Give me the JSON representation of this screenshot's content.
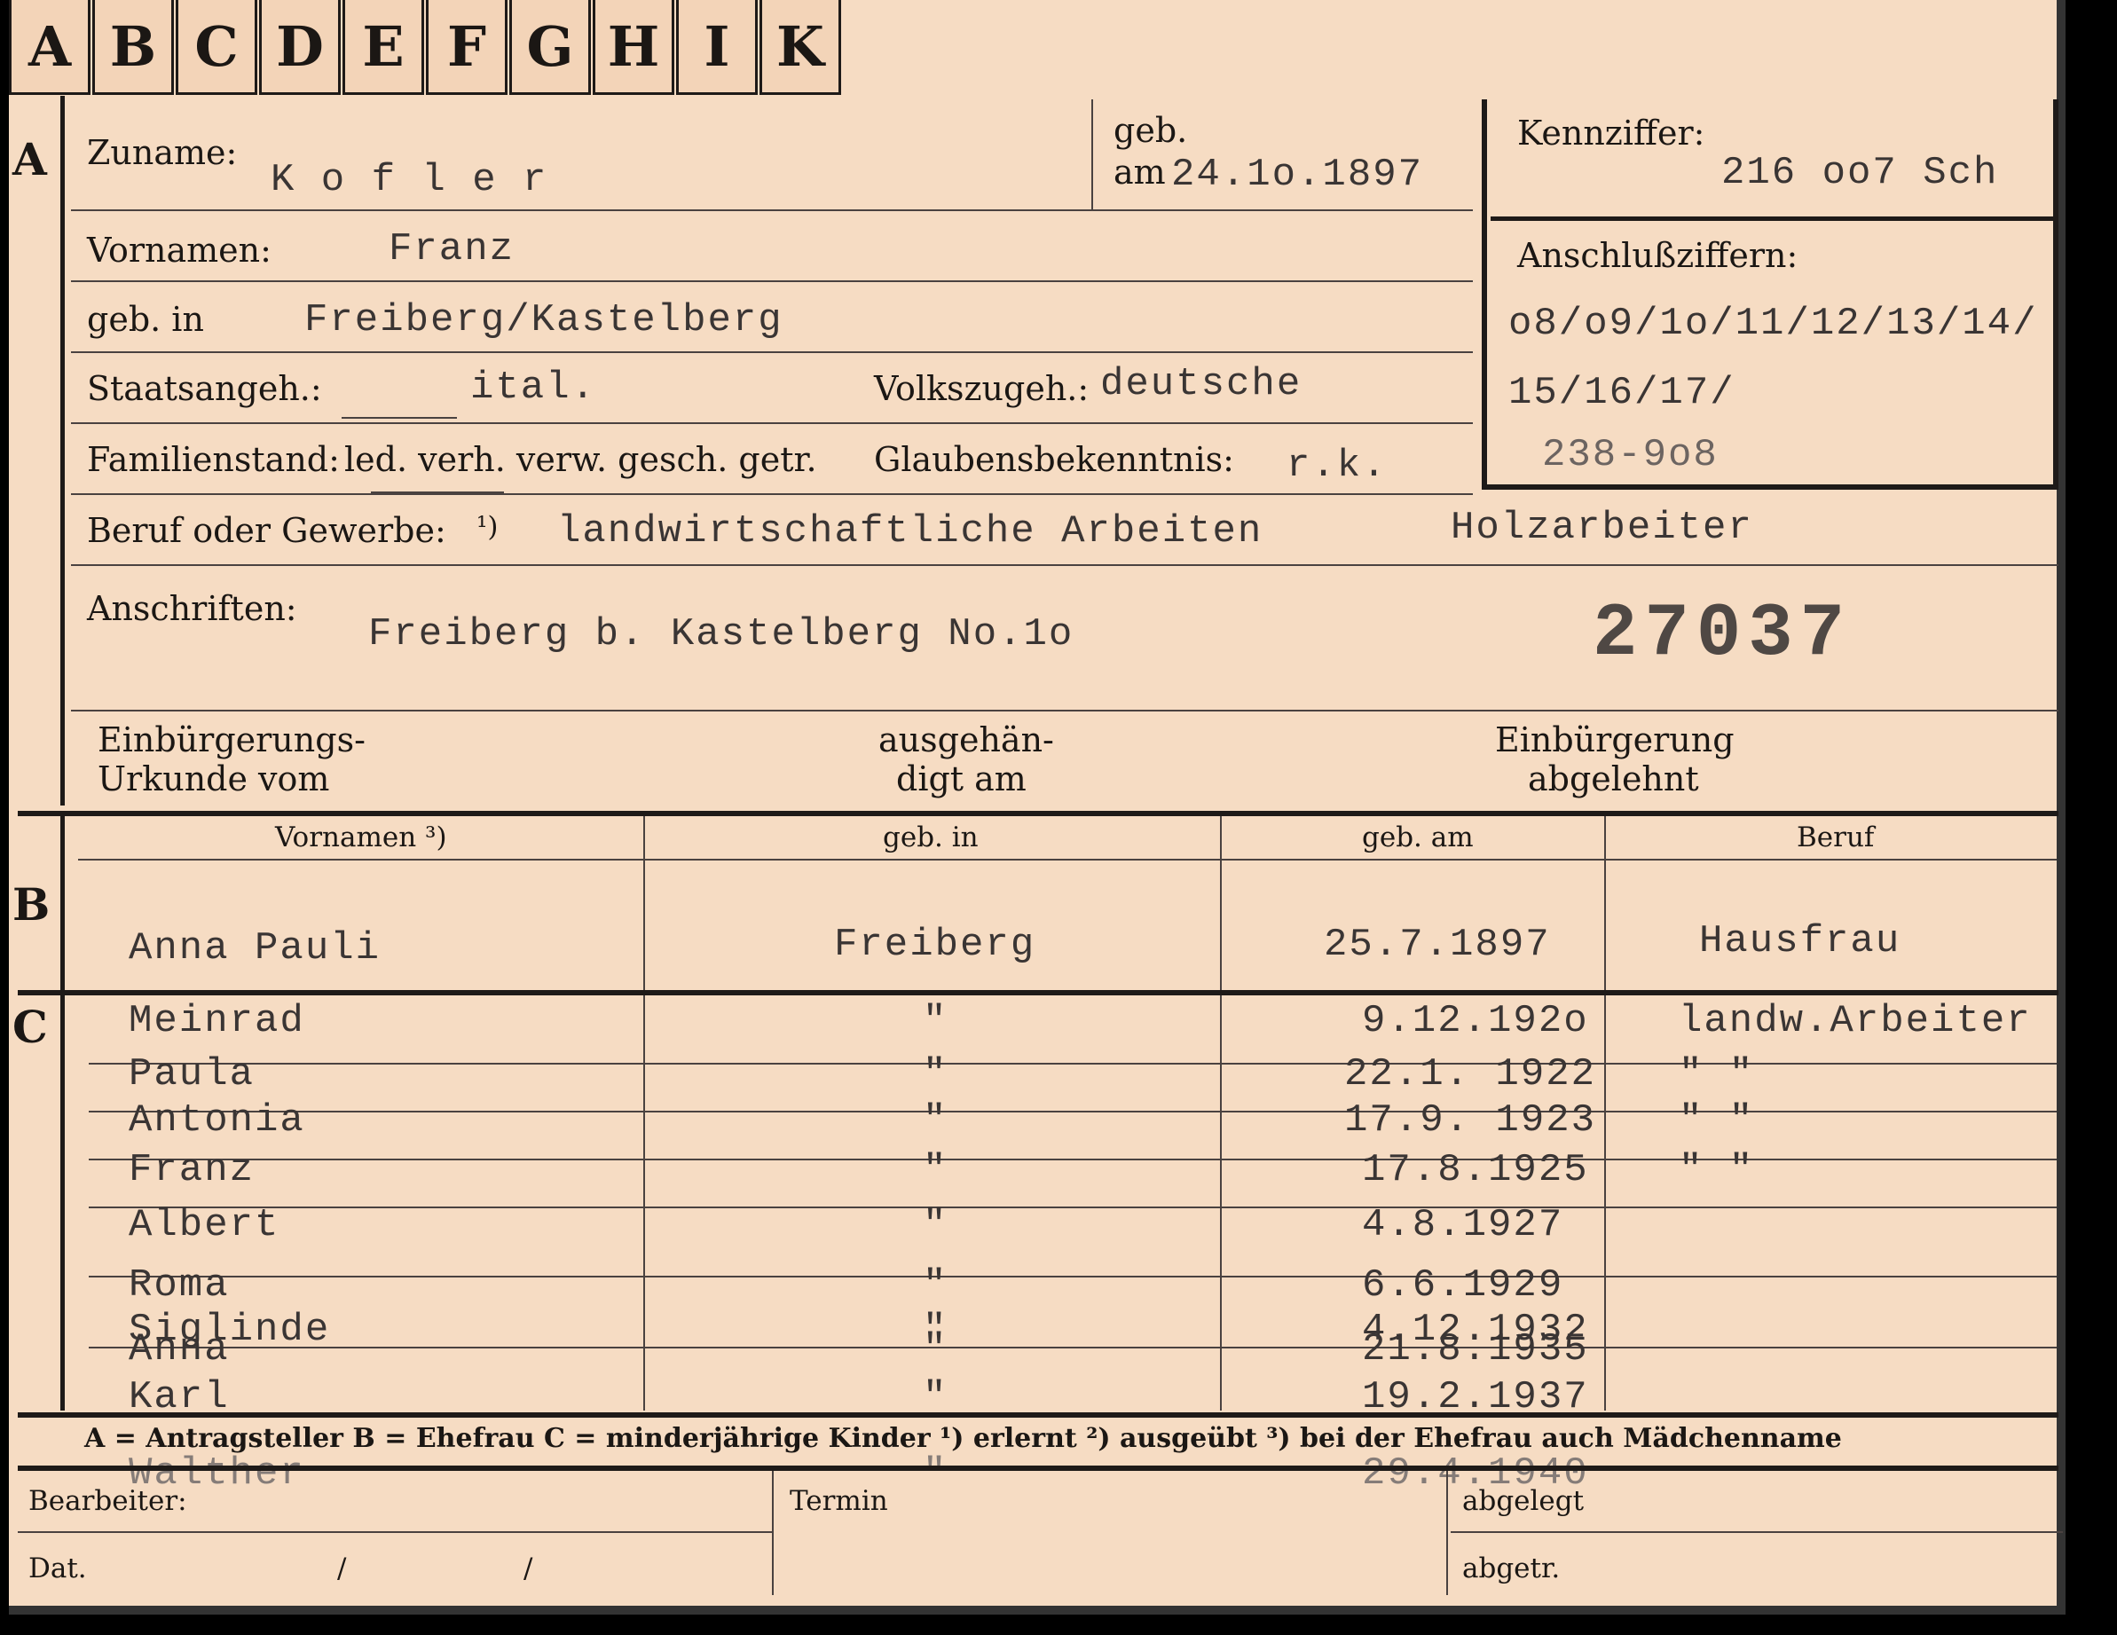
{
  "tabs": [
    "A",
    "B",
    "C",
    "D",
    "E",
    "F",
    "G",
    "H",
    "I",
    "K"
  ],
  "section_letters": {
    "a": "A",
    "b": "B",
    "c": "C"
  },
  "applicant": {
    "surname_label": "Zuname:",
    "surname": "K o f l e r",
    "birth_label_top": "geb.",
    "birth_label_am": "am",
    "birth_date": "24.1o.1897",
    "first_names_label": "Vornamen:",
    "first_names": "Franz",
    "birthplace_label": "geb. in",
    "birthplace": "Freiberg/Kastelberg",
    "citizenship_label": "Staatsangeh.:",
    "citizenship": "ital.",
    "ethnicity_label": "Volkszugeh.:",
    "ethnicity": "deutsche",
    "marital_label": "Familienstand:",
    "marital_options": "led. verh. verw. gesch. getr.",
    "religion_label": "Glaubensbekenntnis:",
    "religion": "r.k.",
    "profession_label": "Beruf oder Gewerbe:",
    "profession_note": "¹)",
    "profession": "landwirtschaftliche Arbeiten",
    "profession2": "Holzarbeiter",
    "address_label": "Anschriften:",
    "address": "Freiberg b. Kastelberg No.1o",
    "stamp_number": "27037"
  },
  "reference": {
    "id_label": "Kennziffer:",
    "id_value": "216 oo7  Sch",
    "connect_label": "Anschlußziffern:",
    "connect_line1": "o8/o9/1o/11/12/13/14/",
    "connect_line2": "15/16/17/",
    "connect_line3": "238-9o8"
  },
  "naturalization": {
    "cert_label_1": "Einbürgerungs-",
    "cert_label_2": "Urkunde vom",
    "handed_label_1": "ausgehän-",
    "handed_label_2": "digt am",
    "rejected_label_1": "Einbürgerung",
    "rejected_label_2": "abgelehnt"
  },
  "table_headers": {
    "names": "Vornamen ³)",
    "birthplace": "geb. in",
    "birthdate": "geb. am",
    "profession": "Beruf"
  },
  "wife": {
    "name": "Anna  Pauli",
    "birthplace": "Freiberg",
    "birthdate": "25.7.1897",
    "profession": "Hausfrau"
  },
  "children": [
    {
      "name": "Meinrad",
      "place": "\"",
      "date": "9.12.192o",
      "profession": "landw.Arbeiter"
    },
    {
      "name": "Paula",
      "place": "\"",
      "date": "22.1. 1922",
      "profession": "\"      \""
    },
    {
      "name": "Antonia",
      "place": "\"",
      "date": "17.9. 1923",
      "profession": "\"      \""
    },
    {
      "name": "Franz",
      "place": "\"",
      "date": "17.8.1925",
      "profession": "\"      \""
    },
    {
      "name": "Albert",
      "place": "\"",
      "date": "4.8.1927",
      "profession": ""
    },
    {
      "name": "Roma",
      "place": "\"",
      "date": "6.6.1929",
      "profession": ""
    },
    {
      "name": "Siglinde",
      "place": "\"",
      "date": "4.12.1932",
      "profession": ""
    },
    {
      "name": "Anna",
      "place": "\"",
      "date": "21.8.1935",
      "profession": ""
    },
    {
      "name": "Karl",
      "place": "\"",
      "date": "19.2.1937",
      "profession": ""
    },
    {
      "name": "Walther",
      "place": "\"",
      "date": "29.4.1940",
      "profession": ""
    }
  ],
  "legend": "A = Antragsteller   B = Ehefrau   C = minderjährige Kinder   ¹) erlernt   ²) ausgeübt   ³) bei der Ehefrau auch Mädchenname",
  "footer": {
    "clerk_label": "Bearbeiter:",
    "date_label": "Dat.",
    "slash1": "/",
    "slash2": "/",
    "deadline_label": "Termin",
    "filed_label": "abgelegt",
    "issued_label": "abgetr."
  }
}
